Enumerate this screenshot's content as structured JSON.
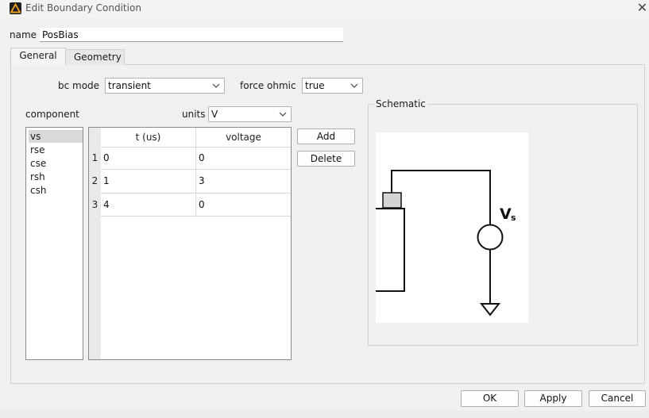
{
  "window": {
    "title": "Edit Boundary Condition",
    "close_glyph": "✕"
  },
  "name_field": {
    "label": "name",
    "value": "PosBias"
  },
  "tabs": [
    {
      "label": "General"
    },
    {
      "label": "Geometry"
    }
  ],
  "bc_mode": {
    "label": "bc mode",
    "value": "transient"
  },
  "force_ohmic": {
    "label": "force ohmic",
    "value": "true"
  },
  "component": {
    "label": "component",
    "items": [
      "vs",
      "rse",
      "cse",
      "rsh",
      "csh"
    ],
    "selected": "vs"
  },
  "units": {
    "label": "units",
    "value": "V"
  },
  "table": {
    "headers": [
      "t (us)",
      "voltage"
    ],
    "rows": [
      {
        "num": "1",
        "t": "0",
        "voltage": "0"
      },
      {
        "num": "2",
        "t": "1",
        "voltage": "3"
      },
      {
        "num": "3",
        "t": "4",
        "voltage": "0"
      }
    ]
  },
  "buttons": {
    "add": "Add",
    "delete": "Delete",
    "ok": "OK",
    "apply": "Apply",
    "cancel": "Cancel"
  },
  "schematic": {
    "label": "Schematic",
    "source_label": "V",
    "source_subscript": "s"
  },
  "icons": {
    "app": "warning-triangle-icon",
    "dropdown": "chevron-down-icon",
    "close": "close-icon"
  },
  "colors": {
    "app_icon_bg": "#1f1f1f",
    "app_icon_fg": "#f5a623"
  }
}
